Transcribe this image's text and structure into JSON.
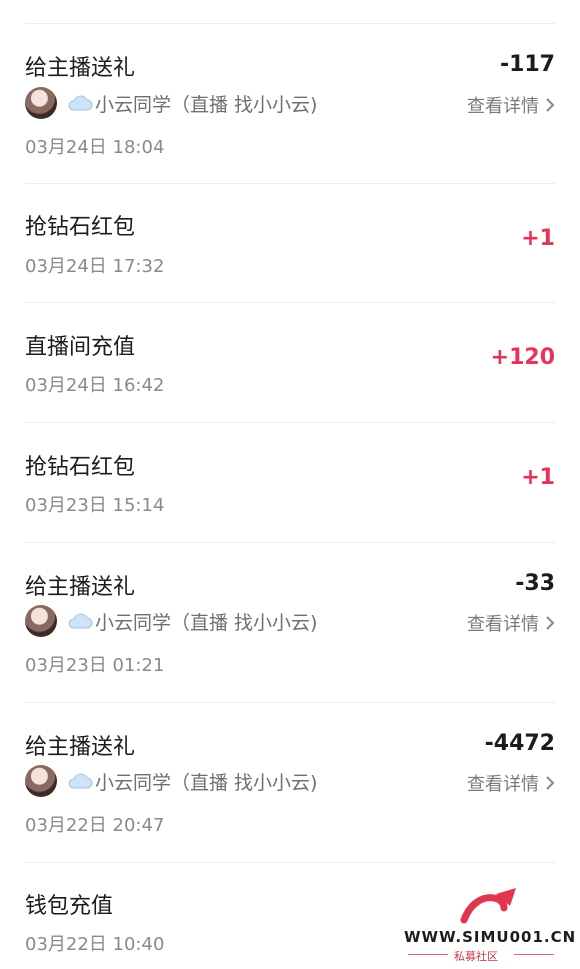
{
  "transactions": [
    {
      "title": "给主播送礼",
      "amount": "-117",
      "type": "neg",
      "anchor": "小云同学（直播 找小小云)",
      "detail": "查看详情",
      "time": "03月24日 18:04"
    },
    {
      "title": "抢钻石红包",
      "amount": "+1",
      "type": "pos",
      "time": "03月24日 17:32"
    },
    {
      "title": "直播间充值",
      "amount": "+120",
      "type": "pos",
      "time": "03月24日 16:42"
    },
    {
      "title": "抢钻石红包",
      "amount": "+1",
      "type": "pos",
      "time": "03月23日 15:14"
    },
    {
      "title": "给主播送礼",
      "amount": "-33",
      "type": "neg",
      "anchor": "小云同学（直播 找小小云)",
      "detail": "查看详情",
      "time": "03月23日 01:21"
    },
    {
      "title": "给主播送礼",
      "amount": "-4472",
      "type": "neg",
      "anchor": "小云同学（直播 找小小云)",
      "detail": "查看详情",
      "time": "03月22日 20:47"
    },
    {
      "title": "钱包充值",
      "time": "03月22日 10:40"
    }
  ],
  "watermark": {
    "site": "WWW.SIMU001.CN",
    "name": "私募社区"
  },
  "colors": {
    "positive": "#e8325a",
    "negative": "#1c1c1c",
    "muted": "#8a8a8a"
  }
}
